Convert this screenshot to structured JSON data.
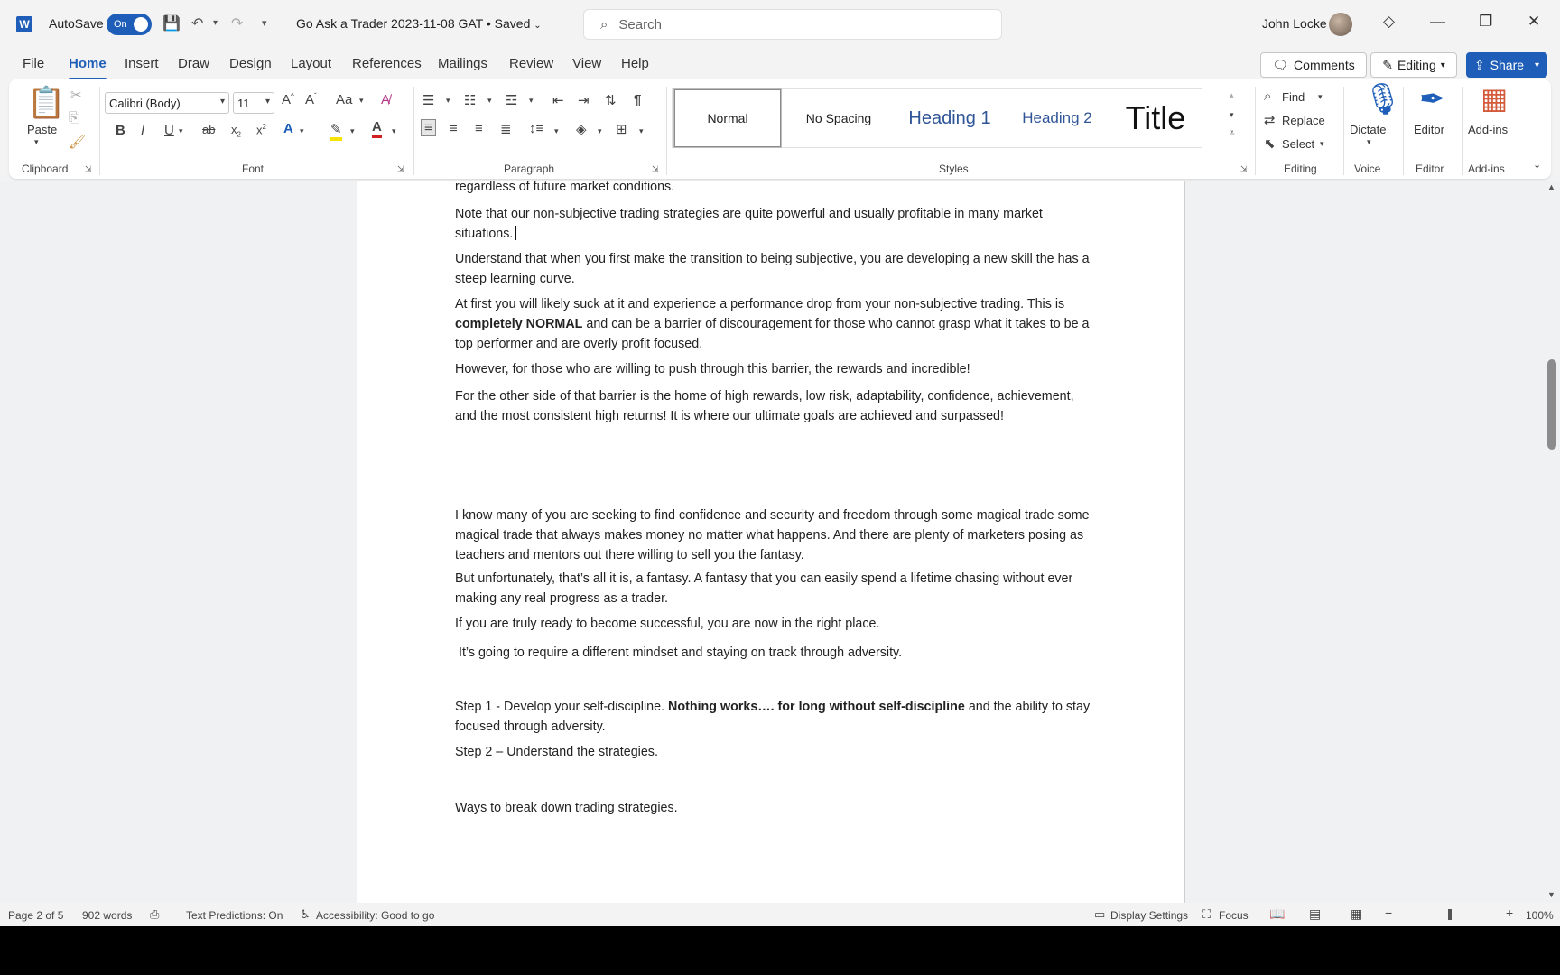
{
  "titlebar": {
    "autosave_label": "AutoSave",
    "autosave_state": "On",
    "doc_title": "Go Ask a Trader 2023-11-08 GAT • Saved",
    "search_placeholder": "Search",
    "user_name": "John Locke"
  },
  "tabs": [
    "File",
    "Home",
    "Insert",
    "Draw",
    "Design",
    "Layout",
    "References",
    "Mailings",
    "Review",
    "View",
    "Help"
  ],
  "actions": {
    "comments": "Comments",
    "editing": "Editing",
    "share": "Share"
  },
  "ribbon": {
    "clipboard": {
      "paste": "Paste",
      "label": "Clipboard"
    },
    "font": {
      "name": "Calibri (Body)",
      "size": "11",
      "label": "Font"
    },
    "paragraph": {
      "label": "Paragraph"
    },
    "styles": {
      "items": [
        "Normal",
        "No Spacing",
        "Heading 1",
        "Heading 2",
        "Title"
      ],
      "label": "Styles"
    },
    "editing": {
      "find": "Find",
      "replace": "Replace",
      "select": "Select",
      "label": "Editing"
    },
    "voice": {
      "dictate": "Dictate",
      "label": "Voice"
    },
    "editor": {
      "editor": "Editor",
      "label": "Editor"
    },
    "addins": {
      "addins": "Add-ins",
      "label": "Add-ins"
    }
  },
  "document": {
    "p0": "regardless of future market conditions.",
    "p1": "Note that our non-subjective trading strategies are quite powerful and usually profitable in many market situations.",
    "p2": "Understand that when you first make the transition to being subjective, you are developing a new skill the has a steep learning curve.",
    "p3a": "At first you will likely suck at it and experience a performance drop from your non-subjective trading. This is ",
    "p3b": "completely NORMAL",
    "p3c": " and can be a barrier of discouragement for those who cannot grasp what it takes to be a top performer and are overly profit focused.",
    "p4": "However, for those who are willing to push through this barrier, the rewards and incredible!",
    "p5": "For the other side of that barrier is the home of high rewards, low risk, adaptability, confidence, achievement, and the most consistent high returns!  It is where our ultimate goals are achieved and surpassed!",
    "p6": "I know many of you are seeking to find confidence and security and freedom through some magical trade some magical trade that always makes money no matter what happens. And there are plenty of marketers posing as teachers and mentors out there willing to sell you the fantasy.",
    "p7": "But unfortunately, that’s all it is, a fantasy. A fantasy that you can easily spend a lifetime chasing without ever making any real progress as a trader.",
    "p8": "If you are truly ready to become successful, you are now in the right place.",
    "p9": " It’s going to require a different mindset and staying on track through adversity.",
    "p10a": "Step 1 - Develop your self-discipline. ",
    "p10b": "Nothing works…. for long without self-discipline",
    "p10c": " and the ability to stay focused through adversity.",
    "p11": "Step 2 – Understand the strategies.",
    "p12": "Ways to break down trading strategies."
  },
  "status": {
    "page": "Page 2 of 5",
    "words": "902 words",
    "predictions": "Text Predictions: On",
    "accessibility": "Accessibility: Good to go",
    "display": "Display Settings",
    "focus": "Focus",
    "zoom": "100%"
  },
  "colors": {
    "accent": "#1e5eb8"
  }
}
